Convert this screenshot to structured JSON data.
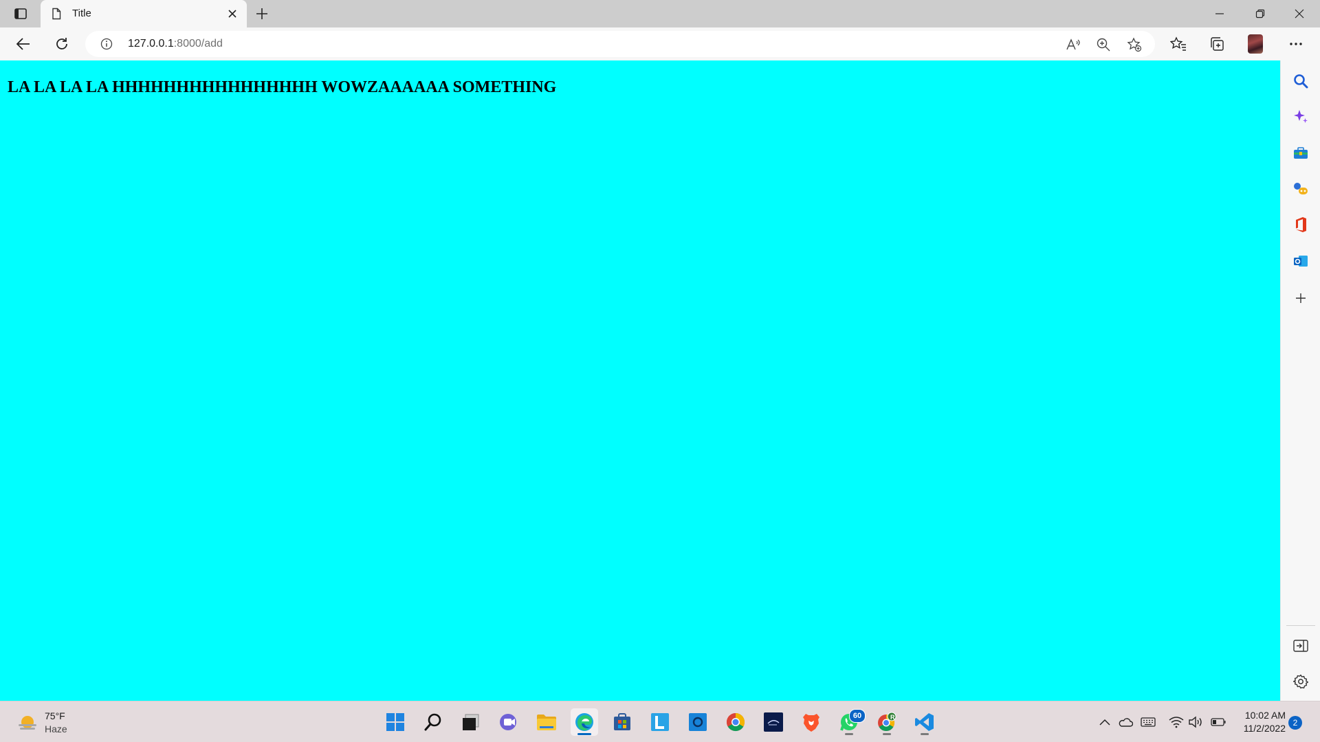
{
  "browser": {
    "tab": {
      "title": "Title"
    },
    "address": {
      "url_host": "127.0.0.1",
      "url_path": ":8000/add"
    }
  },
  "page": {
    "background": "#00ffff",
    "heading": "LA LA LA LA HHHHHHHHHHHHHHHH WOWZAAAAAA SOMETHING"
  },
  "sidebar": {
    "items": [
      "search-icon",
      "copilot-icon",
      "tools-icon",
      "games-icon",
      "office-icon",
      "outlook-icon",
      "add-icon"
    ],
    "bottom": [
      "hide-sidebar-icon",
      "settings-icon"
    ]
  },
  "taskbar": {
    "weather": {
      "temp": "75°F",
      "condition": "Haze"
    },
    "apps": [
      "start-icon",
      "search-icon",
      "task-view-icon",
      "teams-icon",
      "file-explorer-icon",
      "edge-icon",
      "store-icon",
      "l-app-icon",
      "app-icon",
      "chrome-icon",
      "disney-plus-icon",
      "brave-icon",
      "whatsapp-icon",
      "chrome-profile-icon",
      "vscode-icon"
    ],
    "whatsapp_badge": "60",
    "chrome_profile_letter": "R",
    "clock": {
      "time": "10:02 AM",
      "date": "11/2/2022"
    },
    "notification_count": "2"
  }
}
